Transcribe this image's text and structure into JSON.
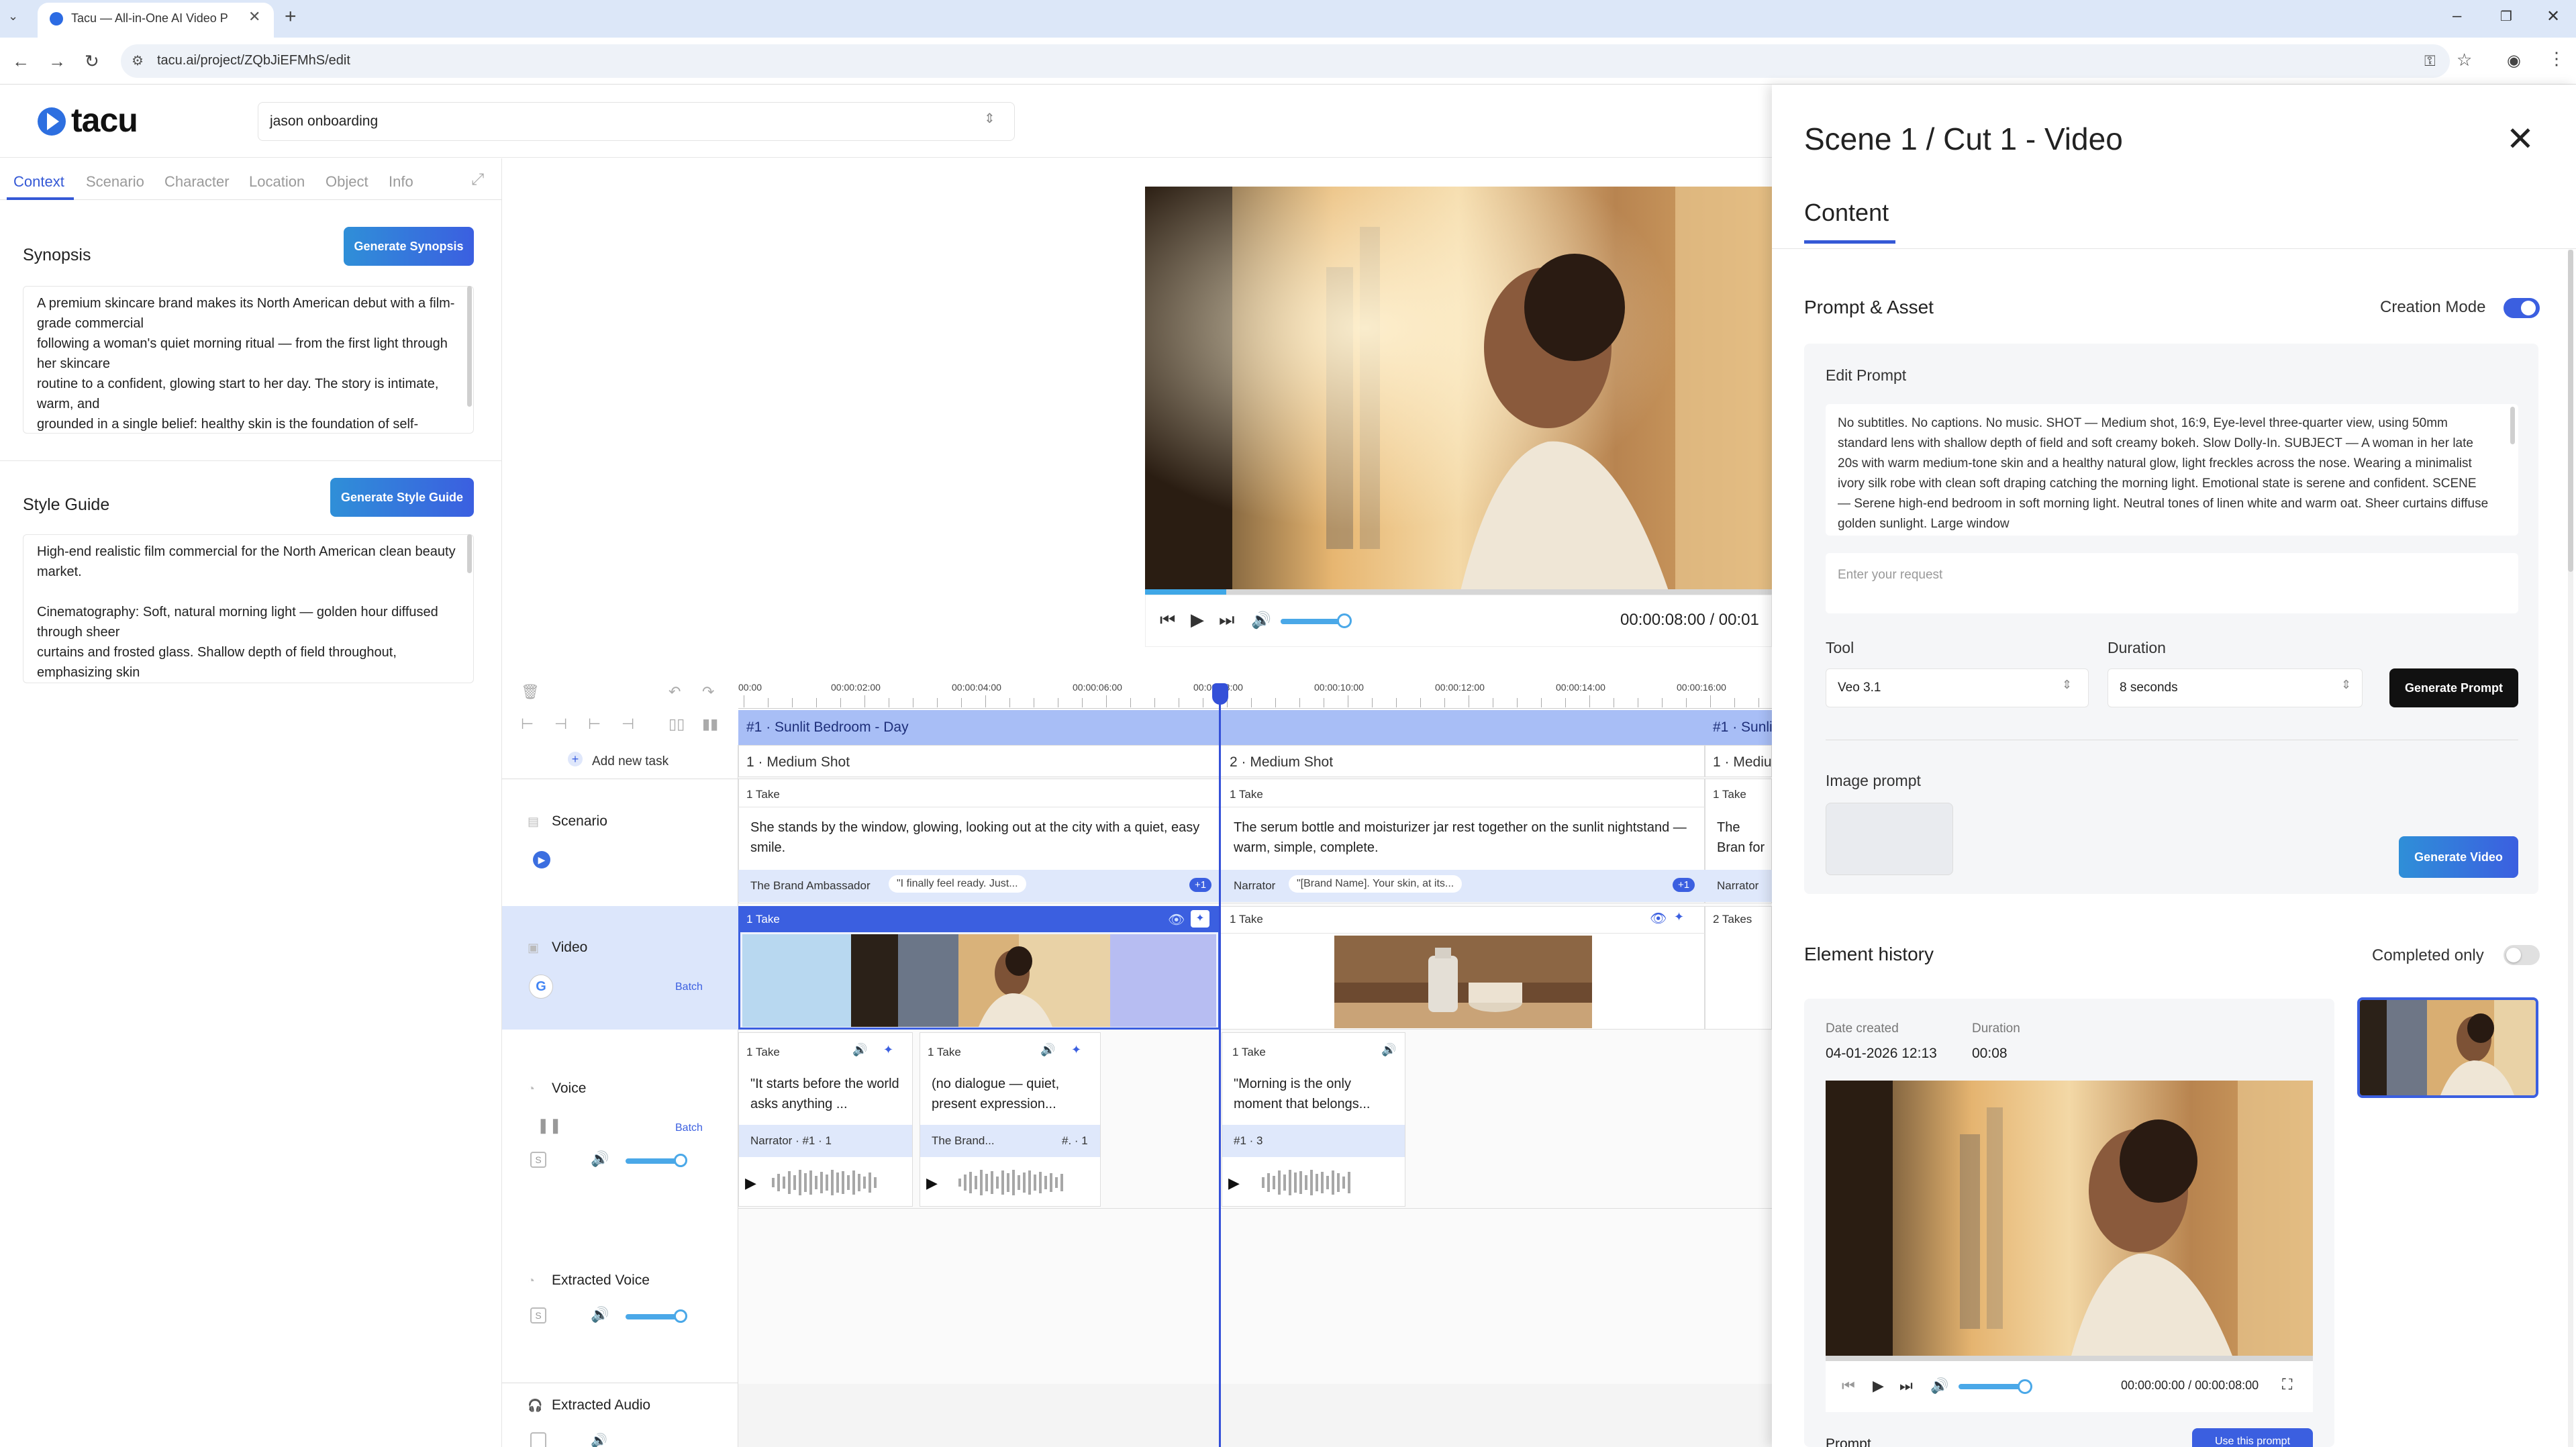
{
  "browser": {
    "tab_title": "Tacu — All-in-One AI Video P",
    "url": "tacu.ai/project/ZQbJiEFMhS/edit"
  },
  "app": {
    "logo_text": "tacu",
    "project_name": "jason onboarding"
  },
  "left_panel": {
    "tabs": [
      {
        "label": "Context"
      },
      {
        "label": "Scenario"
      },
      {
        "label": "Character"
      },
      {
        "label": "Location"
      },
      {
        "label": "Object"
      },
      {
        "label": "Info"
      }
    ],
    "synopsis": {
      "title": "Synopsis",
      "button": "Generate Synopsis",
      "text": "A premium skincare brand makes its North American debut with a film-grade commercial\nfollowing a woman's quiet morning ritual — from the first light through her skincare\nroutine to a confident, glowing start to her day. The story is intimate, warm, and\ngrounded in a single belief: healthy skin is the foundation of self-"
    },
    "style_guide": {
      "title": "Style Guide",
      "button": "Generate Style Guide",
      "text": "High-end realistic film commercial for the North American clean beauty market.\n\nCinematography: Soft, natural morning light — golden hour diffused through sheer\ncurtains and frosted glass. Shallow depth of field throughout, emphasizing skin"
    }
  },
  "preview": {
    "time": "00:00:08:00 / 00:01",
    "progress": 0.13
  },
  "timeline": {
    "add_task": "Add new task",
    "ticks": [
      "00:00",
      "00:00:02:00",
      "00:00:04:00",
      "00:00:06:00",
      "00:00:08:00",
      "00:00:10:00",
      "00:00:12:00",
      "00:00:14:00",
      "00:00:16:00"
    ],
    "scene_1": "#1 · Sunlit Bedroom - Day",
    "scene_2": "#1 · Sunli",
    "rows": {
      "scenario": "Scenario",
      "video": "Video",
      "voice": "Voice",
      "extracted_voice": "Extracted Voice",
      "extracted_audio": "Extracted Audio",
      "batch": "Batch"
    },
    "shots": [
      {
        "head": "1 · Medium Shot",
        "take": "1 Take",
        "text": "She stands by the window, glowing, looking out at the city with a quiet, easy smile.",
        "speaker": "The Brand Ambassador",
        "quote": "\"I finally feel ready. Just...",
        "more": "+1",
        "video_take": "1 Take"
      },
      {
        "head": "2 · Medium Shot",
        "take": "1 Take",
        "text": "The serum bottle and moisturizer jar rest together on the sunlit nightstand — warm, simple, complete.",
        "speaker": "Narrator",
        "quote": "\"[Brand Name]. Your skin, at its...",
        "more": "+1",
        "video_take": "1 Take"
      },
      {
        "head": "1 · Mediu",
        "take": "1 Take",
        "text": "The Bran for the p",
        "speaker": "Narrator",
        "video_take": "2 Takes"
      }
    ],
    "voices": [
      {
        "take": "1 Take",
        "text": "\"It starts before the world asks anything ...",
        "speaker": "Narrator · #1 · 1"
      },
      {
        "take": "1 Take",
        "text": "(no dialogue — quiet, present expression...",
        "speaker": "The Brand...",
        "tag": "#. · 1"
      },
      {
        "take": "1 Take",
        "text": "\"Morning is the only moment that belongs...",
        "speaker": "#1 · 3"
      }
    ]
  },
  "drawer": {
    "title": "Scene 1 / Cut 1 - Video",
    "tab": "Content",
    "prompt_asset": {
      "title": "Prompt & Asset",
      "creation_mode": "Creation Mode",
      "edit_prompt": "Edit Prompt",
      "prompt_text": "No subtitles. No captions. No music. SHOT — Medium shot, 16:9, Eye-level three-quarter view, using 50mm standard lens with shallow depth of field and soft creamy bokeh. Slow Dolly-In. SUBJECT — A woman in her late 20s with warm medium-tone skin and a healthy natural glow, light freckles across the nose. Wearing a minimalist ivory silk robe with clean soft draping catching the morning light. Emotional state is serene and confident. SCENE — Serene high-end bedroom in soft morning light. Neutral tones of linen white and warm oat. Sheer curtains diffuse golden sunlight. Large window",
      "request_placeholder": "Enter your request",
      "tool_label": "Tool",
      "tool_value": "Veo 3.1",
      "duration_label": "Duration",
      "duration_value": "8 seconds",
      "generate_prompt": "Generate Prompt",
      "image_prompt": "Image prompt",
      "generate_video": "Generate Video"
    },
    "history": {
      "title": "Element history",
      "completed_only": "Completed only",
      "date_label": "Date created",
      "date_value": "04-01-2026 12:13",
      "duration_label": "Duration",
      "duration_value": "00:08",
      "time": "00:00:00:00 / 00:00:08:00",
      "prompt_label": "Prompt",
      "use_prompt": "Use this prompt"
    }
  },
  "colors": {
    "accent": "#3b5fe0",
    "scene_bar": "#a8bef6",
    "selected_row": "#dce6fb"
  },
  "icons": [
    "search-icon",
    "close-icon",
    "play-icon",
    "volume-icon",
    "eye-icon",
    "sparkle-icon",
    "trash-icon",
    "undo-icon",
    "redo-icon",
    "expand-icon",
    "chevron-updown-icon",
    "google-icon",
    "pause-icon",
    "fullscreen-icon"
  ]
}
